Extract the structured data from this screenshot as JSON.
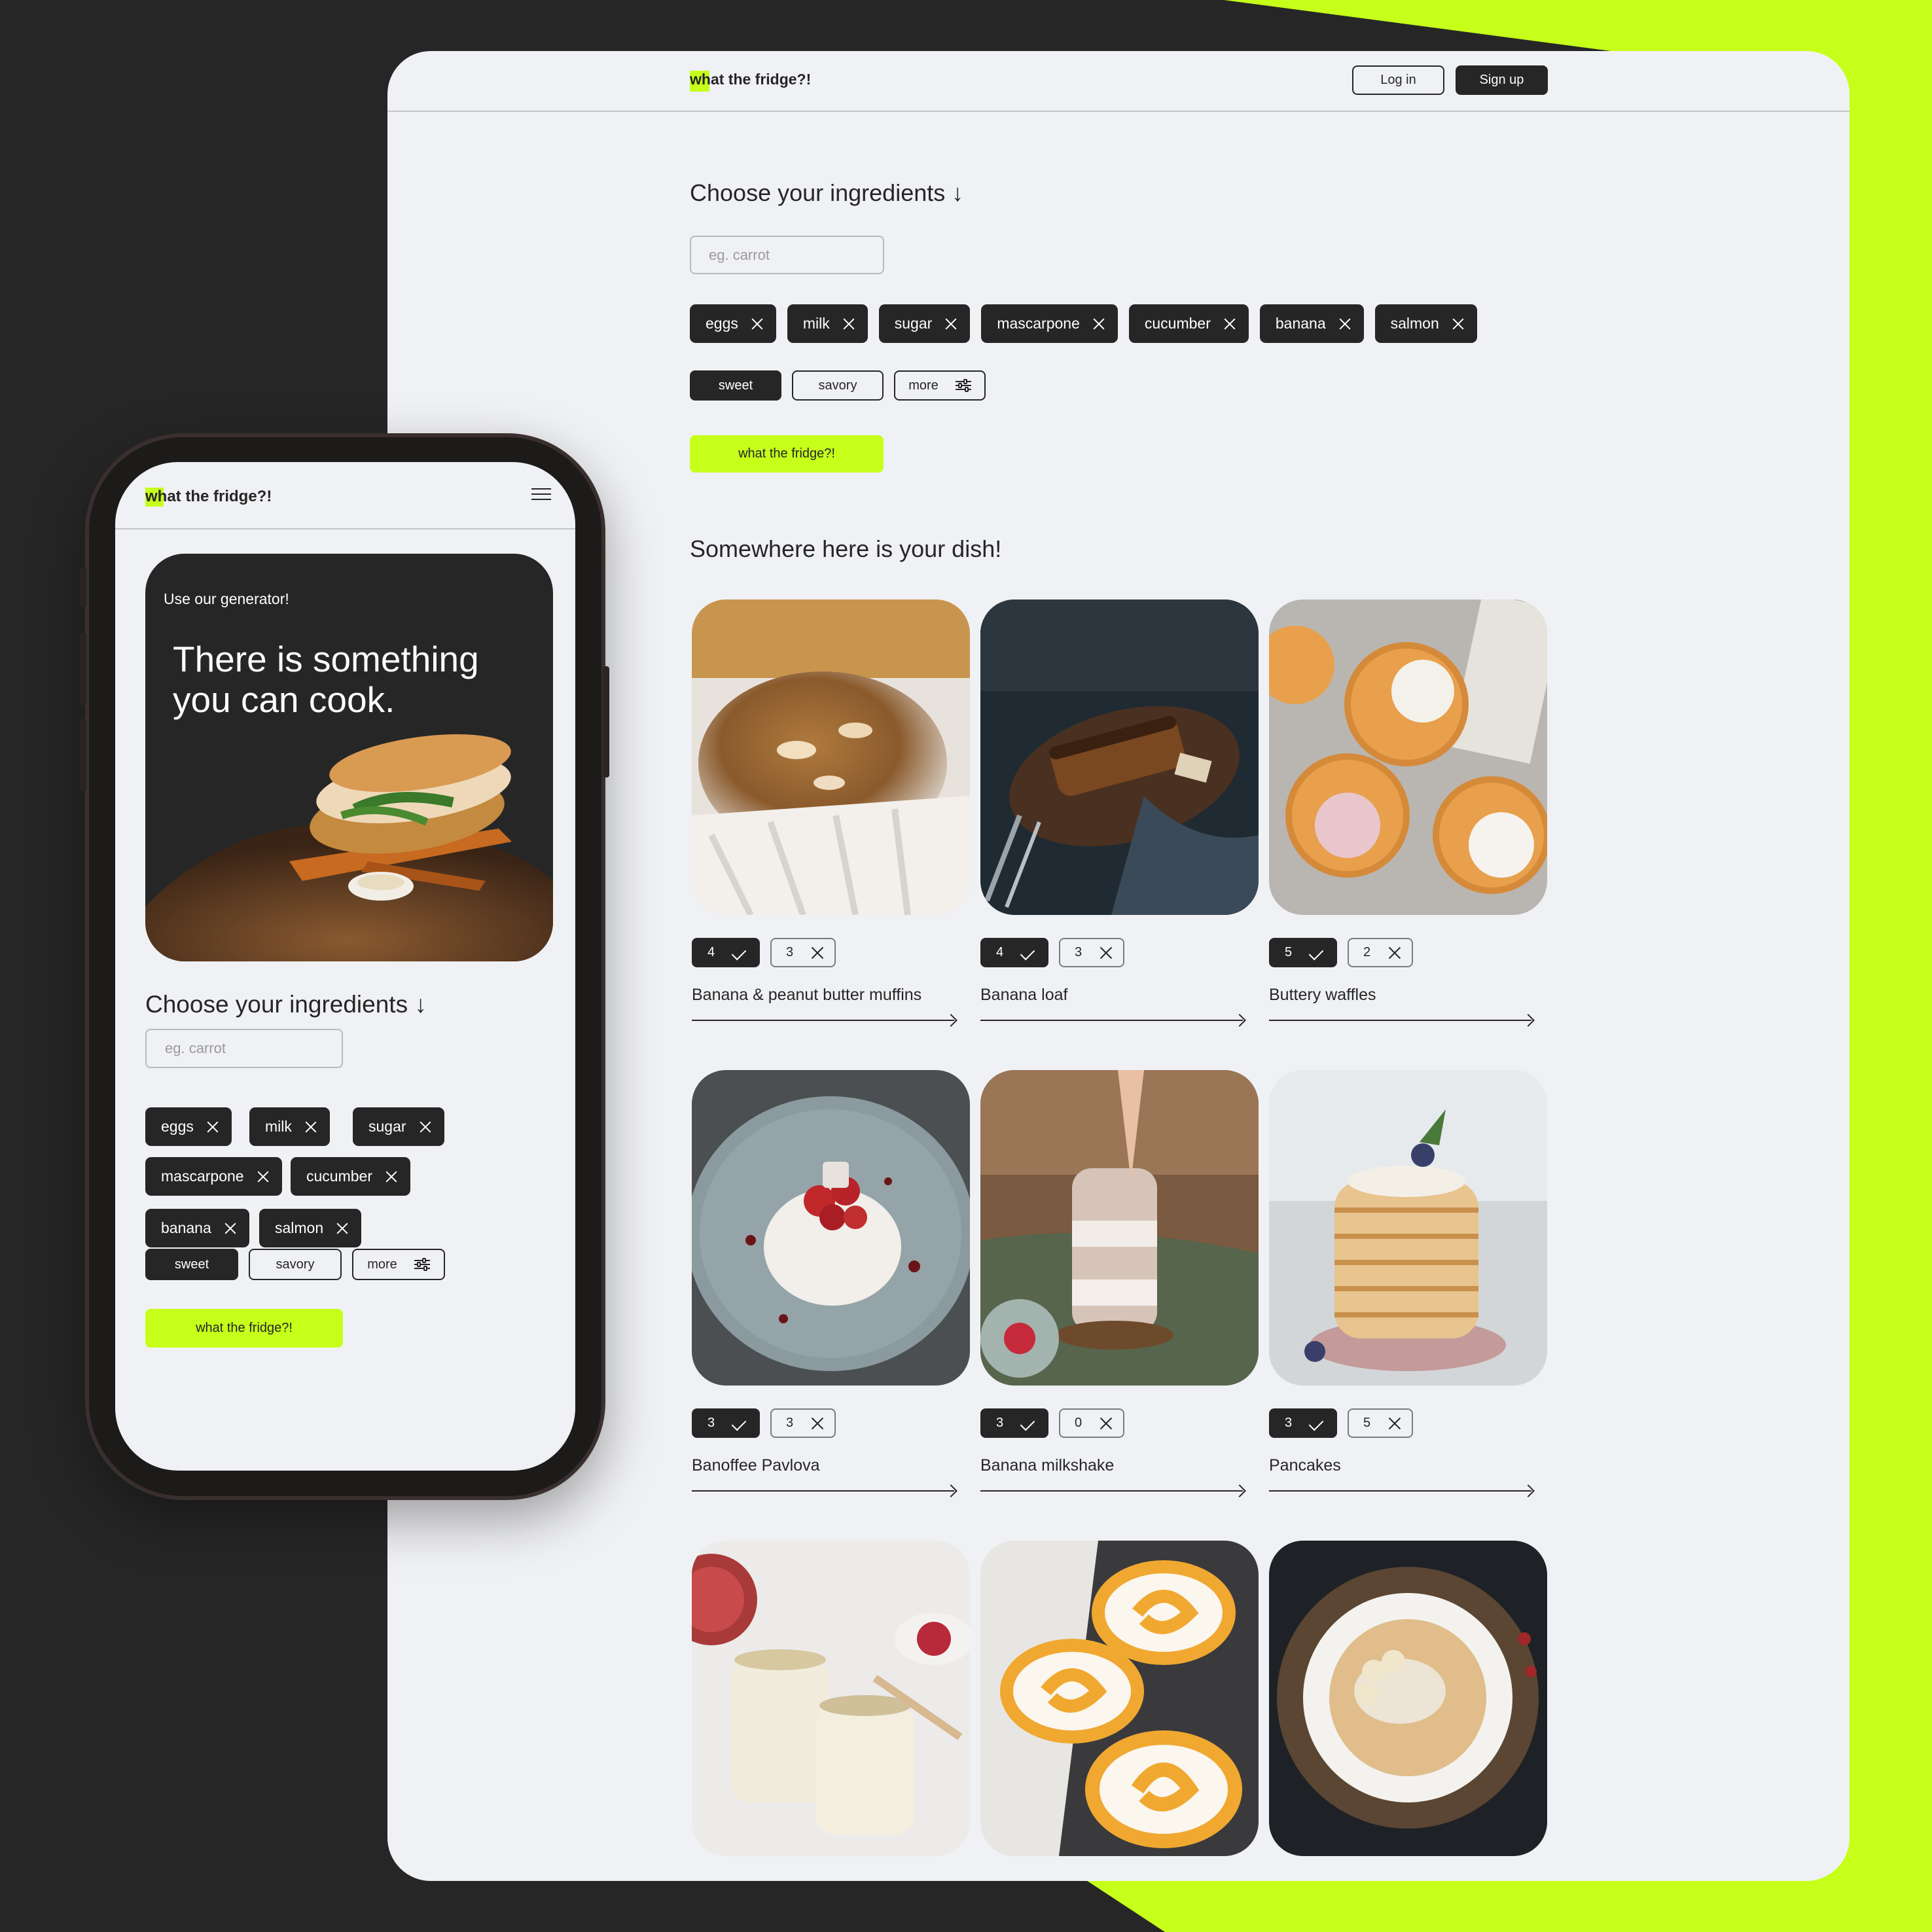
{
  "brand": {
    "logo_first": "w",
    "logo_rest": "hat the fridge?!",
    "accent": "#c5ff1a",
    "dark": "#262626"
  },
  "desktop": {
    "header": {
      "login": "Log in",
      "signup": "Sign up"
    },
    "ingredients_title": "Choose your ingredients ↓",
    "search_placeholder": "eg. carrot",
    "chips": [
      "eggs",
      "milk",
      "sugar",
      "mascarpone",
      "cucumber",
      "banana",
      "salmon"
    ],
    "filters": {
      "sweet": "sweet",
      "savory": "savory",
      "more": "more"
    },
    "cta": "what the fridge?!",
    "results_title": "Somewhere here is your dish!",
    "dishes": [
      {
        "title": "Banana & peanut butter muffins",
        "have": "4",
        "missing": "3"
      },
      {
        "title": "Banana loaf",
        "have": "4",
        "missing": "3"
      },
      {
        "title": "Buttery waffles",
        "have": "5",
        "missing": "2"
      },
      {
        "title": "Banoffee Pavlova",
        "have": "3",
        "missing": "3"
      },
      {
        "title": "Banana milkshake",
        "have": "3",
        "missing": "0"
      },
      {
        "title": "Pancakes",
        "have": "3",
        "missing": "5"
      }
    ]
  },
  "mobile": {
    "hero_small": "Use our generator!",
    "hero_big": "There is something\nyou can cook.",
    "ingredients_title": "Choose your ingredients ↓",
    "search_placeholder": "eg. carrot",
    "chips": [
      "eggs",
      "milk",
      "sugar",
      "mascarpone",
      "cucumber",
      "banana",
      "salmon"
    ],
    "filters": {
      "sweet": "sweet",
      "savory": "savory",
      "more": "more"
    },
    "cta": "what the fridge?!"
  }
}
